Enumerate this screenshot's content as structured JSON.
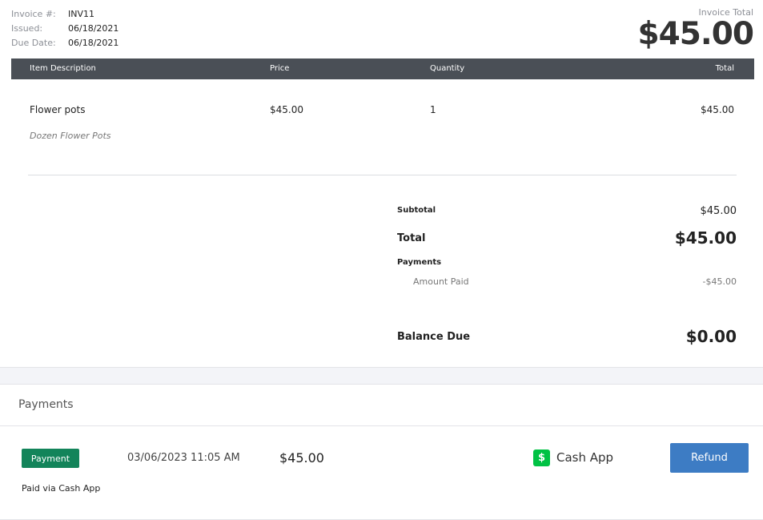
{
  "invoice": {
    "meta": [
      {
        "label": "Invoice #:",
        "value": "INV11"
      },
      {
        "label": "Issued:",
        "value": "06/18/2021"
      },
      {
        "label": "Due Date:",
        "value": "06/18/2021"
      }
    ],
    "total_label": "Invoice Total",
    "total_amount": "$45.00"
  },
  "table": {
    "headers": [
      "Item Description",
      "Price",
      "Quantity",
      "Total"
    ],
    "rows": [
      {
        "name": "Flower pots",
        "description": "Dozen Flower Pots",
        "price": "$45.00",
        "quantity": "1",
        "total": "$45.00"
      }
    ]
  },
  "summary": {
    "subtotal_label": "Subtotal",
    "subtotal_value": "$45.00",
    "total_label": "Total",
    "total_value": "$45.00",
    "payments_label": "Payments",
    "amount_paid_label": "Amount Paid",
    "amount_paid_value": "-$45.00",
    "balance_label": "Balance Due",
    "balance_value": "$0.00"
  },
  "payments": {
    "title": "Payments",
    "entry": {
      "badge": "Payment",
      "date": "03/06/2023 11:05 AM",
      "amount": "$45.00",
      "method_icon": "$",
      "method": "Cash App",
      "note": "Paid via Cash App",
      "refund_label": "Refund"
    }
  },
  "colors": {
    "header_bg": "#4a4f56",
    "badge": "#13845a",
    "cashapp": "#00c244",
    "refund_button": "#3d7cc4"
  }
}
